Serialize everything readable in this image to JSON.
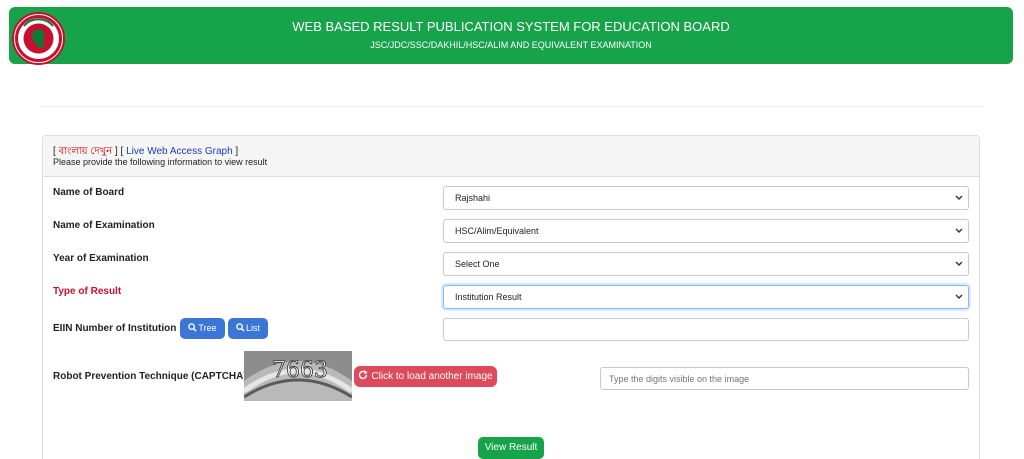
{
  "header": {
    "title": "WEB BASED RESULT PUBLICATION SYSTEM FOR EDUCATION BOARD",
    "subtitle": "JSC/JDC/SSC/DAKHIL/HSC/ALIM AND EQUIVALENT EXAMINATION",
    "logo_icon": "bangladesh-govt-seal-icon"
  },
  "panel": {
    "bracket_open": "[ ",
    "bangla_link": "বাংলায় দেখুন",
    "separator": " ] [ ",
    "graph_link": "Live Web Access Graph",
    "bracket_close": " ]",
    "info": "Please provide the following information to view result"
  },
  "form": {
    "board_label": "Name of Board",
    "board_value": "Rajshahi",
    "exam_label": "Name of Examination",
    "exam_value": "HSC/Alim/Equivalent",
    "year_label": "Year of Examination",
    "year_value": "Select One",
    "result_type_label": "Type of Result",
    "result_type_value": "Institution Result",
    "eiin_label": "EIIN Number of Institution",
    "eiin_value": "",
    "tree_button": "Tree",
    "list_button": "List",
    "captcha_label": "Robot Prevention Technique (CAPTCHA)",
    "captcha_text": "7663",
    "reload_button": "Click to load another image",
    "captcha_placeholder": "Type the digits visible on the image",
    "submit_button": "View Result"
  },
  "colors": {
    "header_bg": "#16a34a",
    "link_red": "#d00000",
    "link_blue": "#1a3bbd",
    "button_blue": "#3b76d6",
    "button_red": "#dc4a5c",
    "submit_green": "#16a34a"
  }
}
